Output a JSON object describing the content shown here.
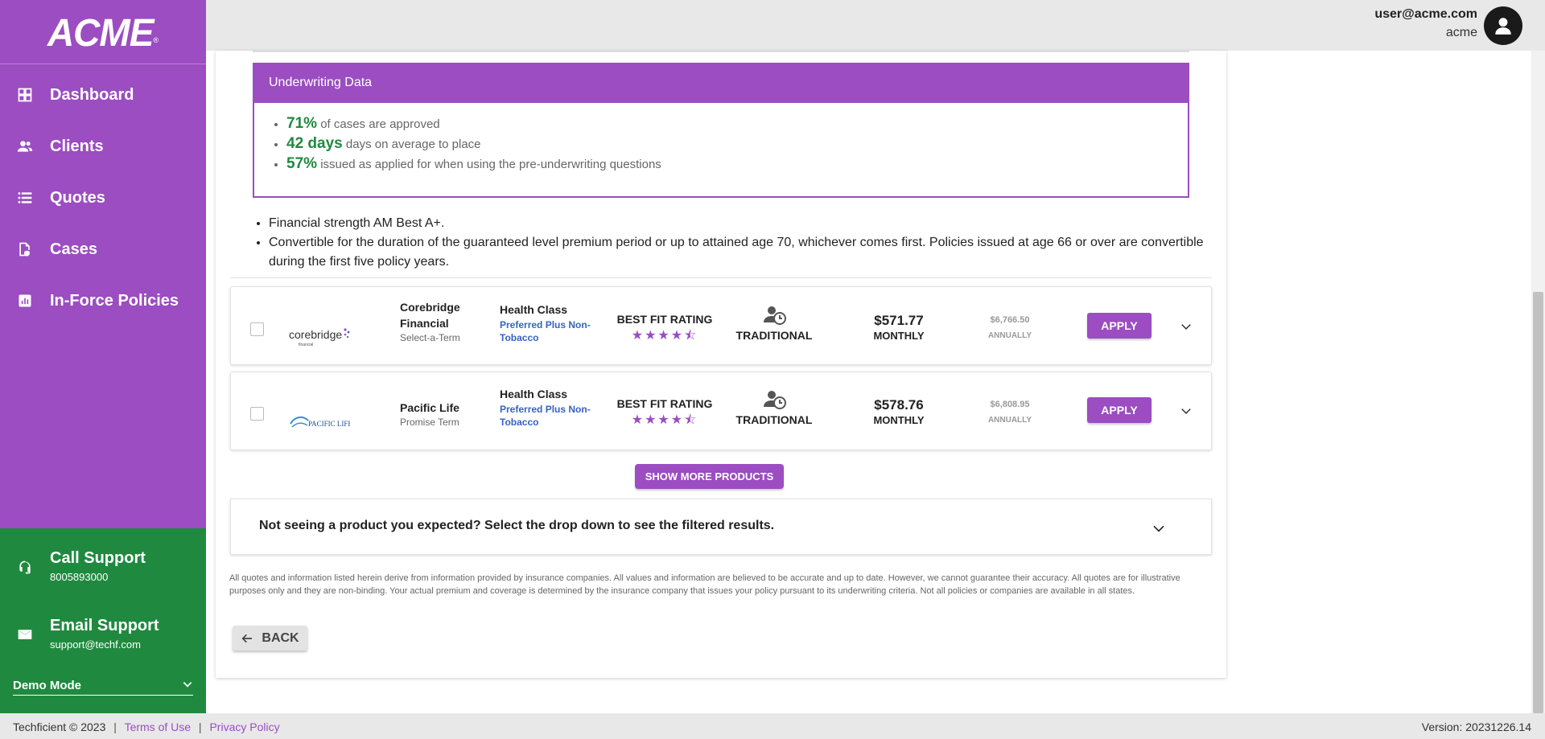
{
  "brand": {
    "logo_text": "ACME",
    "logo_mark": "®"
  },
  "sidebar": {
    "items": [
      {
        "label": "Dashboard",
        "icon": "dashboard-icon"
      },
      {
        "label": "Clients",
        "icon": "clients-icon"
      },
      {
        "label": "Quotes",
        "icon": "quotes-icon"
      },
      {
        "label": "Cases",
        "icon": "cases-icon"
      },
      {
        "label": "In-Force Policies",
        "icon": "chart-icon"
      }
    ],
    "support": {
      "call_title": "Call Support",
      "call_value": "8005893000",
      "email_title": "Email Support",
      "email_value": "support@techf.com"
    },
    "demo_mode": "Demo Mode"
  },
  "header": {
    "email": "user@acme.com",
    "org": "acme"
  },
  "underwriting": {
    "title": "Underwriting Data",
    "items": [
      {
        "big": "71%",
        "text": " of cases are approved"
      },
      {
        "big": "42 days",
        "text": " days on average to place"
      },
      {
        "big": "57%",
        "text": " issued as applied for when using the pre-underwriting questions"
      }
    ]
  },
  "features": [
    "Financial strength AM Best A+.",
    "Convertible for the duration of the guaranteed level premium period or up to attained age 70, whichever comes first. Policies issued at age 66 or over are convertible during the first five policy years."
  ],
  "products": [
    {
      "logo_name": "corebridge",
      "logo_sub": "financial",
      "carrier": "Corebridge Financial",
      "plan": "Select-a-Term",
      "health_class_label": "Health Class",
      "health_class": "Preferred Plus Non-Tobacco",
      "rating_label": "BEST FIT RATING",
      "rating": 4.5,
      "underwriting_type": "TRADITIONAL",
      "monthly": "$571.77",
      "monthly_label": "MONTHLY",
      "annual": "$6,766.50",
      "annual_label": "ANNUALLY",
      "apply_label": "APPLY"
    },
    {
      "logo_name": "PACIFIC LIFE",
      "carrier": "Pacific Life",
      "plan": "Promise Term",
      "health_class_label": "Health Class",
      "health_class": "Preferred Plus Non-Tobacco",
      "rating_label": "BEST FIT RATING",
      "rating": 4.5,
      "underwriting_type": "TRADITIONAL",
      "monthly": "$578.76",
      "monthly_label": "MONTHLY",
      "annual": "$6,808.95",
      "annual_label": "ANNUALLY",
      "apply_label": "APPLY"
    }
  ],
  "show_more_label": "SHOW MORE PRODUCTS",
  "not_seeing": "Not seeing a product you expected? Select the drop down to see the filtered results.",
  "disclaimer": "All quotes and information listed herein derive from information provided by insurance companies. All values and information are believed to be accurate and up to date. However, we cannot guarantee their accuracy. All quotes are for illustrative purposes only and they are non-binding. Your actual premium and coverage is determined by the insurance company that issues your policy pursuant to its underwriting criteria. Not all policies or companies are available in all states.",
  "back_label": "BACK",
  "footer": {
    "copyright": "Techficient © 2023",
    "terms": "Terms of Use",
    "privacy": "Privacy Policy",
    "sep": "|",
    "version": "Version: 20231226.14"
  },
  "colors": {
    "brand": "#9b4dc1",
    "support": "#1f8a3f",
    "stat": "#1f8a3f",
    "health_class": "#3563c4"
  }
}
